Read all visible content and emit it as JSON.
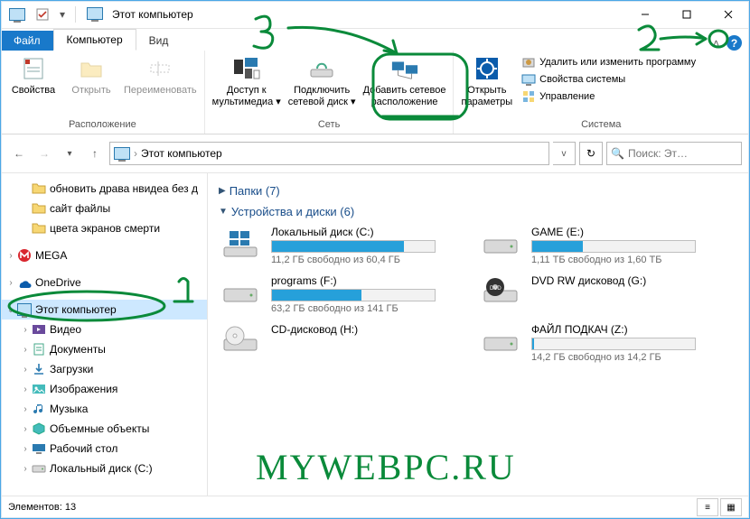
{
  "title": "Этот компьютер",
  "tabs": {
    "file": "Файл",
    "computer": "Компьютер",
    "view": "Вид"
  },
  "ribbon": {
    "location": {
      "label": "Расположение",
      "props": "Свойства",
      "open": "Открыть",
      "rename": "Переименовать"
    },
    "network": {
      "label": "Сеть",
      "media": "Доступ к\nмультимедиа",
      "map": "Подключить\nсетевой диск",
      "add": "Добавить сетевое\nрасположение"
    },
    "system": {
      "label": "Система",
      "settings": "Открыть\nпараметры",
      "uninstall": "Удалить или изменить программу",
      "sysprops": "Свойства системы",
      "manage": "Управление"
    }
  },
  "address": {
    "text": "Этот компьютер",
    "search_placeholder": "Поиск: Эт…"
  },
  "tree": [
    {
      "depth": 1,
      "exp": "",
      "icon": "folder",
      "label": "обновить драва нвидеа без д"
    },
    {
      "depth": 1,
      "exp": "",
      "icon": "folder",
      "label": "сайт файлы"
    },
    {
      "depth": 1,
      "exp": "",
      "icon": "folder",
      "label": "цвета экранов смерти"
    },
    {
      "depth": 0,
      "exp": ">",
      "icon": "mega",
      "label": "MEGA"
    },
    {
      "depth": 0,
      "exp": ">",
      "icon": "onedrive",
      "label": "OneDrive"
    },
    {
      "depth": 0,
      "exp": "v",
      "icon": "pc",
      "label": "Этот компьютер",
      "selected": true
    },
    {
      "depth": 1,
      "exp": ">",
      "icon": "video",
      "label": "Видео"
    },
    {
      "depth": 1,
      "exp": ">",
      "icon": "docs",
      "label": "Документы"
    },
    {
      "depth": 1,
      "exp": ">",
      "icon": "downloads",
      "label": "Загрузки"
    },
    {
      "depth": 1,
      "exp": ">",
      "icon": "pictures",
      "label": "Изображения"
    },
    {
      "depth": 1,
      "exp": ">",
      "icon": "music",
      "label": "Музыка"
    },
    {
      "depth": 1,
      "exp": ">",
      "icon": "objects",
      "label": "Объемные объекты"
    },
    {
      "depth": 1,
      "exp": ">",
      "icon": "desktop",
      "label": "Рабочий стол"
    },
    {
      "depth": 1,
      "exp": ">",
      "icon": "drive",
      "label": "Локальный диск (С:)"
    }
  ],
  "sections": {
    "folders": "Папки (7)",
    "drives": "Устройства и диски (6)"
  },
  "drives": [
    {
      "name": "Локальный диск (C:)",
      "sub": "11,2 ГБ свободно из 60,4 ГБ",
      "fill": 81,
      "icon": "win"
    },
    {
      "name": "GAME (E:)",
      "sub": "1,11 ТБ свободно из 1,60 ТБ",
      "fill": 31,
      "icon": "hdd"
    },
    {
      "name": "programs (F:)",
      "sub": "63,2 ГБ свободно из 141 ГБ",
      "fill": 55,
      "icon": "hdd"
    },
    {
      "name": "DVD RW дисковод (G:)",
      "sub": "",
      "fill": -1,
      "icon": "dvd"
    },
    {
      "name": "CD-дисковод (H:)",
      "sub": "",
      "fill": -1,
      "icon": "cd"
    },
    {
      "name": "ФАЙЛ ПОДКАЧ (Z:)",
      "sub": "14,2 ГБ свободно из 14,2 ГБ",
      "fill": 1,
      "icon": "hdd"
    }
  ],
  "status": "Элементов: 13",
  "annotations": {
    "n1": "1",
    "n2": "2",
    "n3": "3",
    "watermark": "mywebpc.ru"
  }
}
